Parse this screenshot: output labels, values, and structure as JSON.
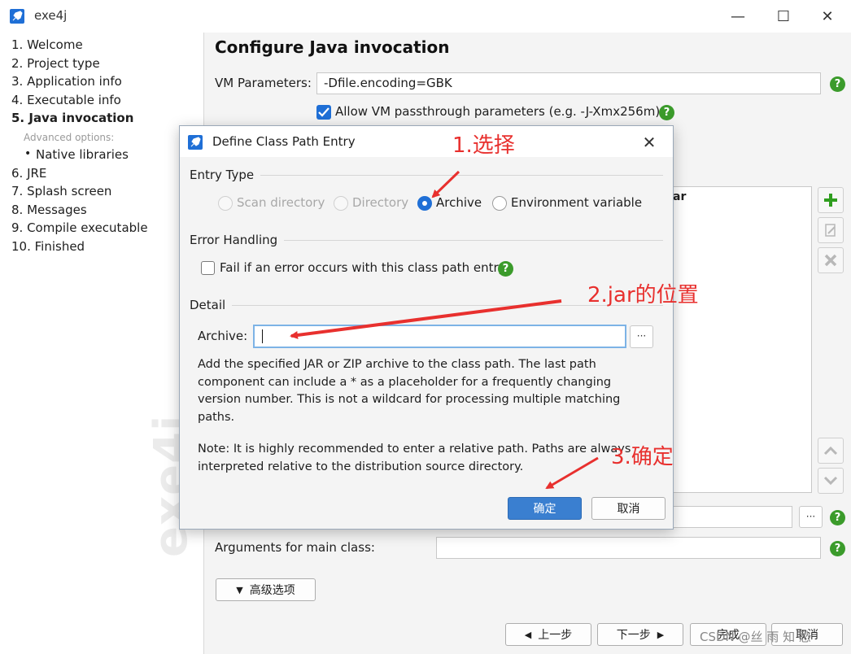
{
  "window": {
    "title": "exe4j",
    "minimize": "—",
    "maximize": "☐",
    "close": "✕"
  },
  "sidebar": {
    "steps": [
      {
        "label": "1. Welcome"
      },
      {
        "label": "2. Project type"
      },
      {
        "label": "3. Application info"
      },
      {
        "label": "4. Executable info"
      },
      {
        "label": "5. Java invocation",
        "active": true
      },
      {
        "label": "6. JRE"
      },
      {
        "label": "7. Splash screen"
      },
      {
        "label": "8. Messages"
      },
      {
        "label": "9. Compile executable"
      },
      {
        "label": "10. Finished"
      }
    ],
    "advanced_label": "Advanced options:",
    "native_bullet": "•",
    "native_libraries": "Native libraries",
    "watermark": "exe4j"
  },
  "main": {
    "title": "Configure Java invocation",
    "vm_params_label": "VM Parameters:",
    "vm_params_value": "-Dfile.encoding=GBK",
    "allow_passthrough_label": "Allow VM passthrough parameters (e.g. -J-Xmx256m)",
    "allow_passthrough_checked": true,
    "classpath_visible_text": "ar",
    "args_label": "Arguments for main class:",
    "args_value": "",
    "advanced_button": "高级选项",
    "help_glyph": "?",
    "dots_glyph": "···"
  },
  "footer": {
    "prev": "上一步",
    "next": "下一步",
    "finish": "完成",
    "cancel": "取消"
  },
  "dialog": {
    "title": "Define Class Path Entry",
    "close": "✕",
    "entry_type_label": "Entry Type",
    "options": [
      {
        "label": "Scan directory",
        "state": "disabled"
      },
      {
        "label": "Directory",
        "state": "disabled"
      },
      {
        "label": "Archive",
        "state": "selected"
      },
      {
        "label": "Environment variable",
        "state": "normal"
      }
    ],
    "error_handling_label": "Error Handling",
    "fail_label": "Fail if an error occurs with this class path entry",
    "fail_checked": false,
    "detail_label": "Detail",
    "archive_label": "Archive:",
    "archive_value": "",
    "browse_glyph": "···",
    "desc_lines": [
      "Add the specified JAR or ZIP archive to the class path. The last path",
      "component can include a * as a placeholder for a frequently changing",
      "version number. This is not a wildcard for processing multiple matching",
      "paths."
    ],
    "note_lines": [
      "Note: It is highly recommended to enter a relative path. Paths are always",
      "interpreted relative to the distribution source directory."
    ],
    "ok": "确定",
    "cancel": "取消"
  },
  "annotations": {
    "step1": "1.选择",
    "step2": "2.jar的位置",
    "step3": "3.确定",
    "color": "#e8302e"
  },
  "watermark_footer": "CSDN @丝 雨 知 愁",
  "colors": {
    "accent": "#1f6fd6",
    "help": "#3b9b2b",
    "ok_button": "#3a7fd0",
    "annotation": "#e8302e"
  }
}
